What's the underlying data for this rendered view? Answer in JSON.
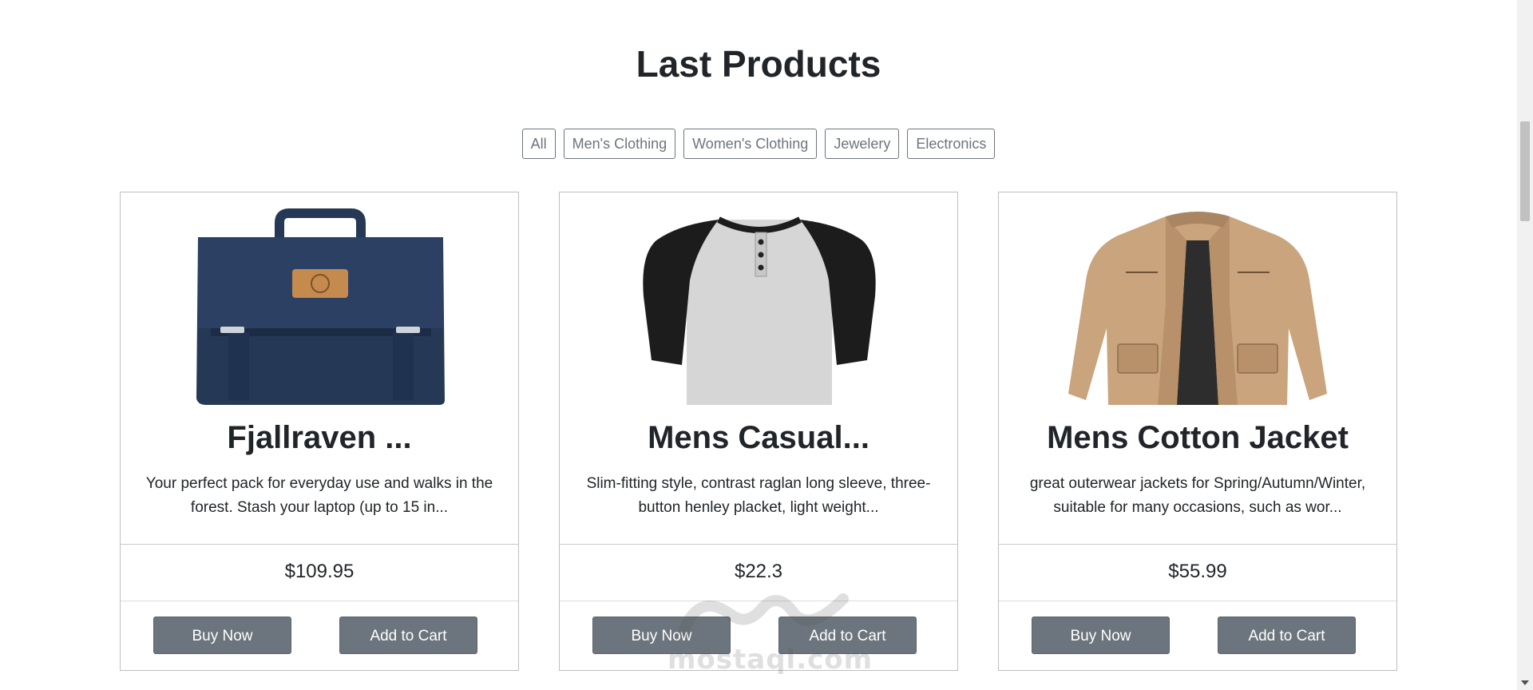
{
  "section": {
    "title": "Last Products"
  },
  "filters": [
    {
      "label": "All"
    },
    {
      "label": "Men's Clothing"
    },
    {
      "label": "Women's Clothing"
    },
    {
      "label": "Jewelery"
    },
    {
      "label": "Electronics"
    }
  ],
  "products": [
    {
      "name": "Fjallraven ...",
      "description": "Your perfect pack for everyday use and walks in the forest. Stash your laptop (up to 15 in...",
      "price": "$109.95",
      "buy_label": "Buy Now",
      "cart_label": "Add to Cart",
      "image": "backpack"
    },
    {
      "name": "Mens Casual...",
      "description": "Slim-fitting style, contrast raglan long sleeve, three-button henley placket, light weight...",
      "price": "$22.3",
      "buy_label": "Buy Now",
      "cart_label": "Add to Cart",
      "image": "raglan-henley-shirt"
    },
    {
      "name": "Mens Cotton Jacket",
      "description": "great outerwear jackets for Spring/Autumn/Winter, suitable for many occasions, such as wor...",
      "price": "$55.99",
      "buy_label": "Buy Now",
      "cart_label": "Add to Cart",
      "image": "cotton-jacket"
    }
  ],
  "watermark": {
    "text": "mostaql.com"
  },
  "colors": {
    "button_bg": "#6c757d",
    "filter_border": "#6c757d",
    "text": "#212529",
    "backpack": "#253856",
    "jacket": "#c9a47c"
  }
}
